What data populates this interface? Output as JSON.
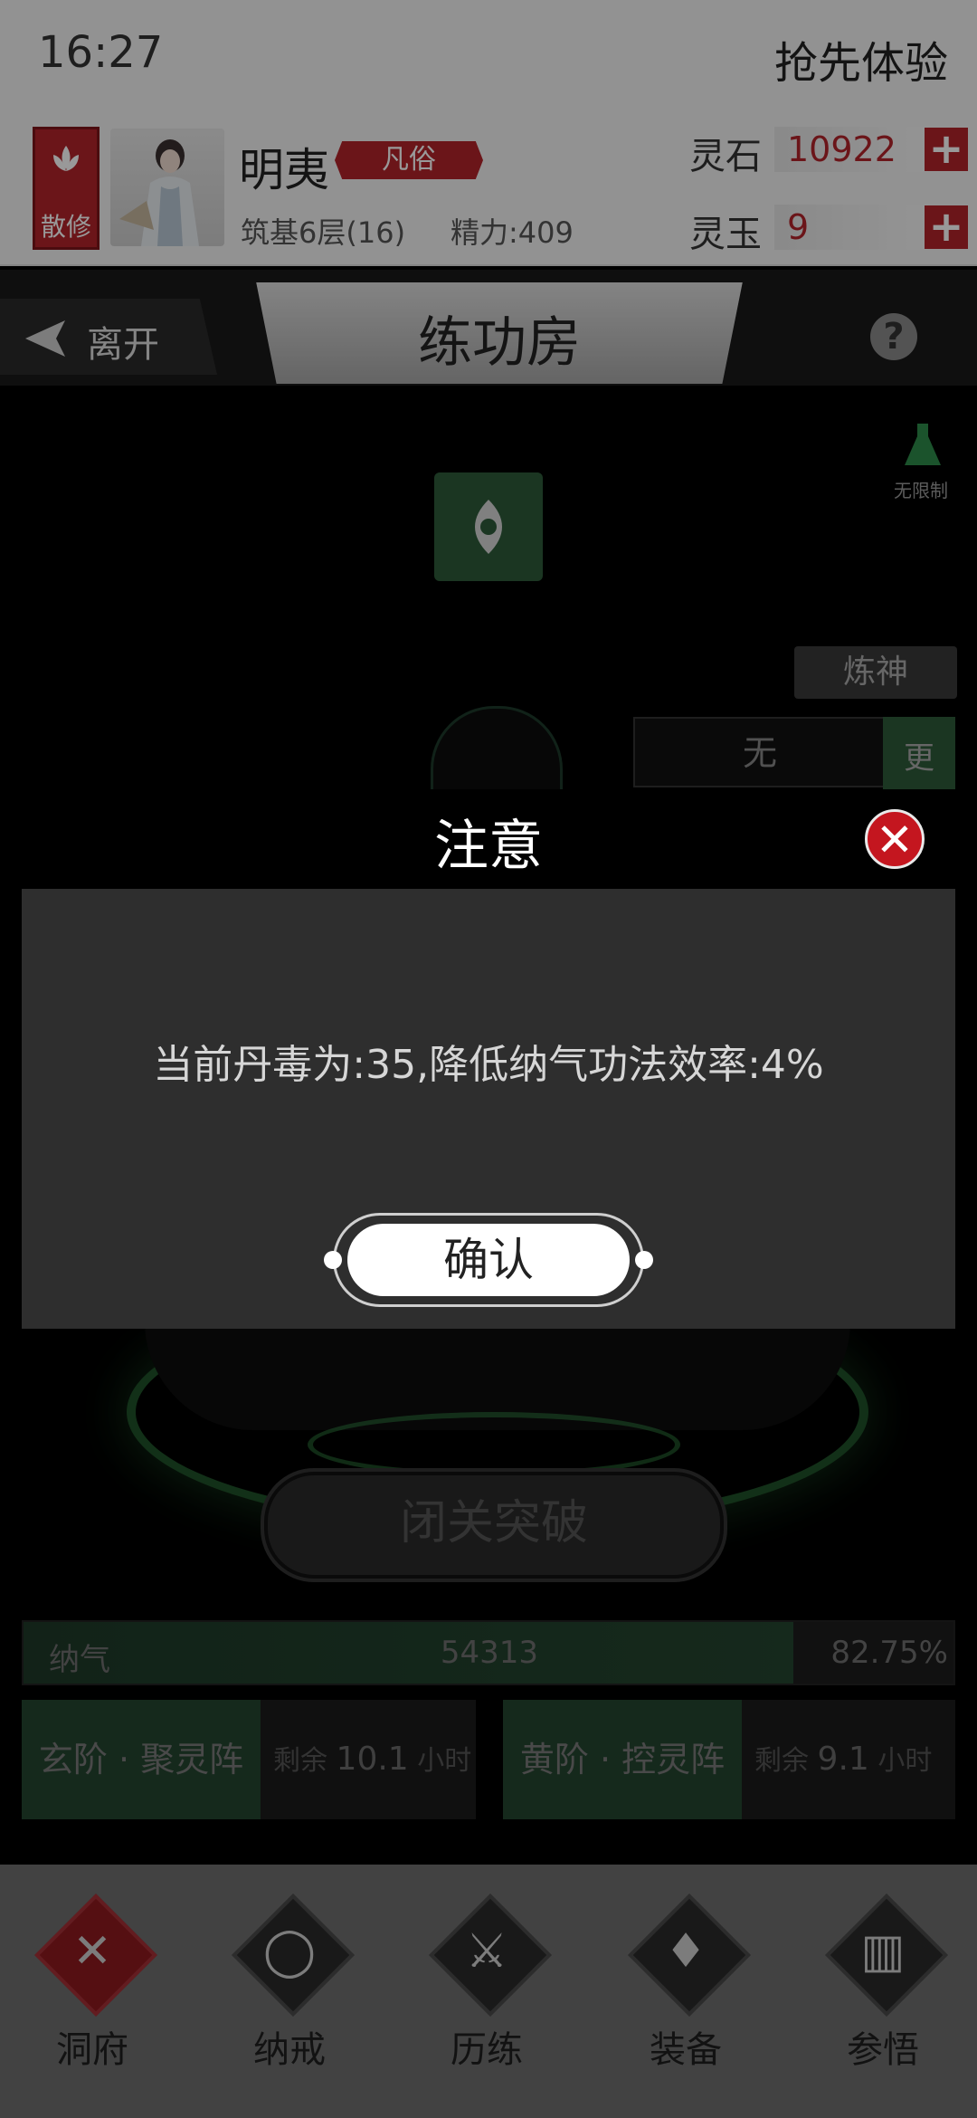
{
  "status": {
    "time": "16:27",
    "promo": "抢先体验"
  },
  "player": {
    "badge": "散修",
    "name": "明夷",
    "rank": "凡俗",
    "level": "筑基6层(16)",
    "energy": "精力:409"
  },
  "currency": {
    "stone_label": "灵石",
    "stone_value": "10922",
    "jade_label": "灵玉",
    "jade_value": "9"
  },
  "titlebar": {
    "leave": "离开",
    "title": "练功房"
  },
  "scene": {
    "unlimited": "无限制",
    "lianshen": "炼神",
    "wu": "无",
    "geng": "更",
    "breakthrough": "闭关突破",
    "qi_label": "纳气",
    "qi_value": "54313",
    "qi_pct": "82.75%",
    "qi_fraction": 0.8275,
    "formations": [
      {
        "name": "玄阶 · 聚灵阵",
        "remain_prefix": "剩余",
        "remain_value": "10.1",
        "remain_unit": "小时"
      },
      {
        "name": "黄阶 · 控灵阵",
        "remain_prefix": "剩余",
        "remain_value": "9.1",
        "remain_unit": "小时"
      }
    ]
  },
  "nav": [
    {
      "label": "洞府",
      "icon": "cave-icon",
      "active": true
    },
    {
      "label": "纳戒",
      "icon": "ring-icon",
      "active": false
    },
    {
      "label": "历练",
      "icon": "crossed-swords-icon",
      "active": false
    },
    {
      "label": "装备",
      "icon": "sword-equipment-icon",
      "active": false
    },
    {
      "label": "参悟",
      "icon": "book-icon",
      "active": false
    }
  ],
  "modal": {
    "title": "注意",
    "message": "当前丹毒为:35,降低纳气功法效率:4%",
    "confirm": "确认"
  },
  "colors": {
    "accent": "#b3242b",
    "jade_green": "#2d5a3a",
    "modal_bg": "#2e2e2e"
  }
}
